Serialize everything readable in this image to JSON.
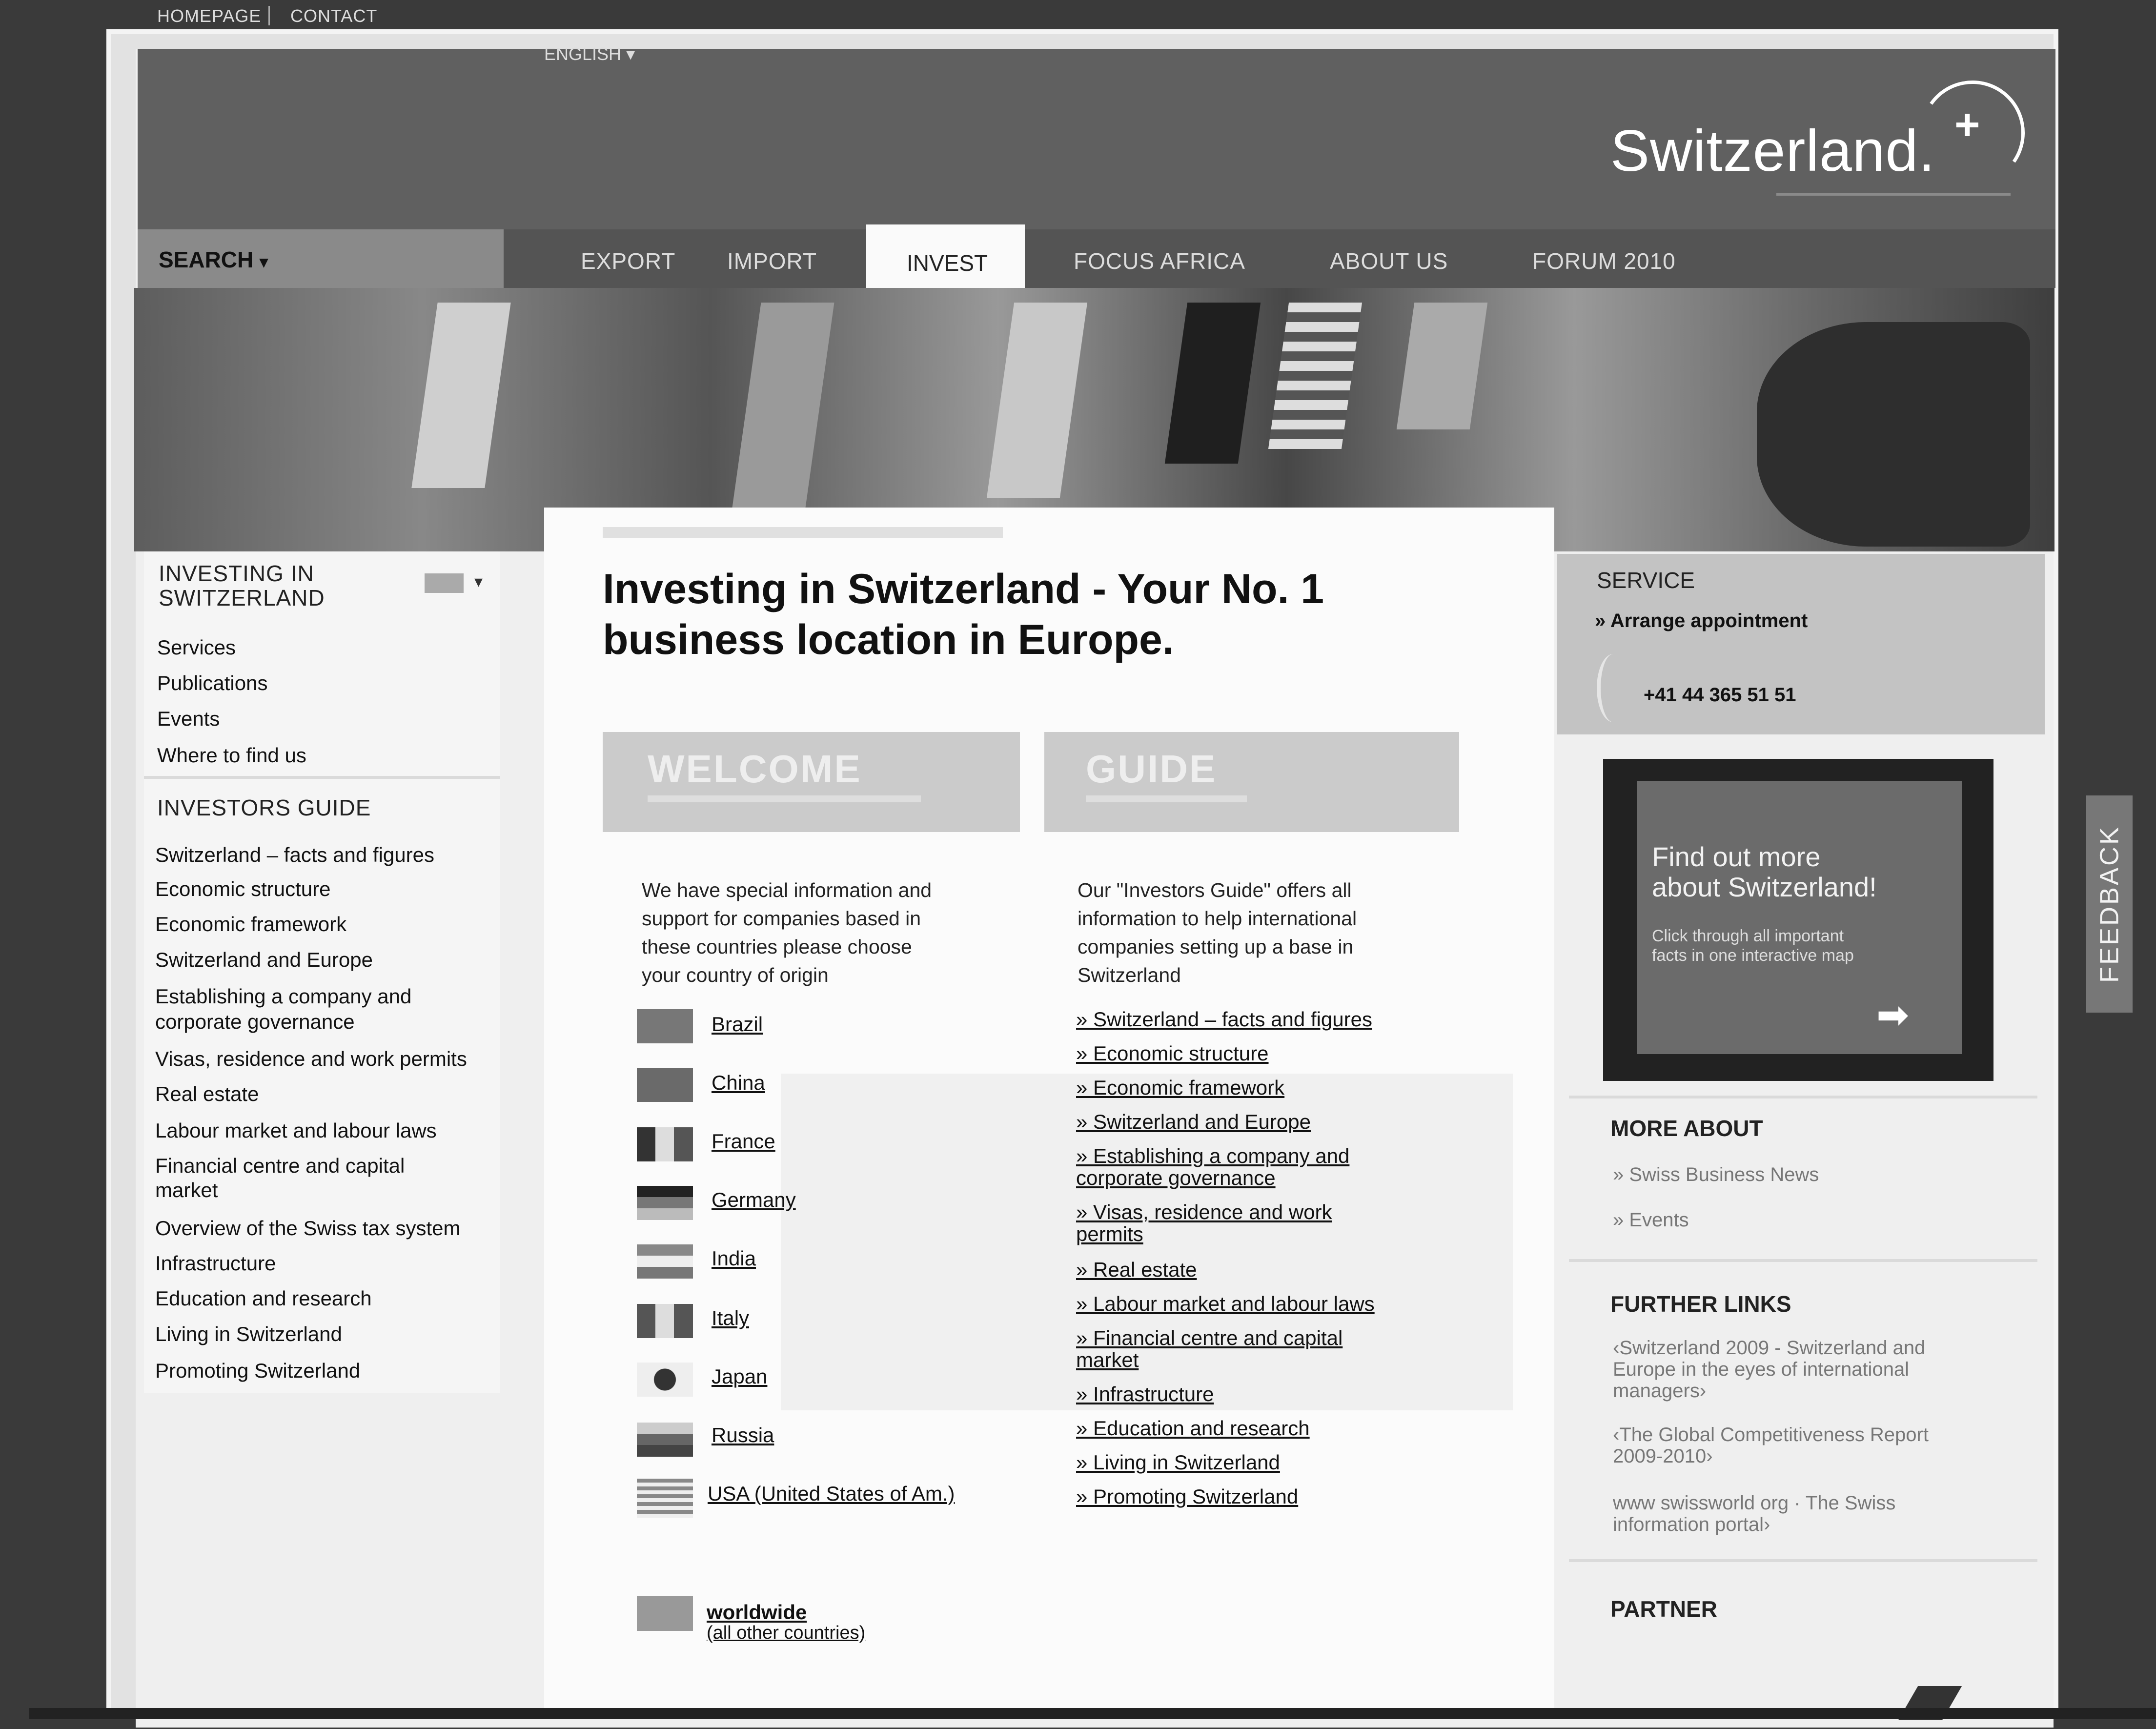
{
  "header": {
    "top_links": [
      "HOMEPAGE",
      "CONTACT"
    ],
    "language": "ENGLISH",
    "logo_text": "Switzerland.",
    "logo_symbol": "+"
  },
  "nav": {
    "search_label": "SEARCH",
    "search_caret": "▾",
    "items": [
      "EXPORT",
      "IMPORT",
      "INVEST",
      "FOCUS AFRICA",
      "ABOUT US",
      "FORUM 2010"
    ]
  },
  "left_nav": {
    "section_title_line1": "INVESTING IN",
    "section_title_line2": "SWITZERLAND",
    "items": [
      "Services",
      "Publications",
      "Events",
      "Where to find us"
    ],
    "guide_title": "INVESTORS GUIDE",
    "guide_items": [
      "Switzerland – facts and figures",
      "Economic structure",
      "Economic framework",
      "Switzerland and Europe",
      "Establishing a company and",
      "corporate governance",
      "Visas, residence and work permits",
      "Real estate",
      "Labour market and labour laws",
      "Financial centre and capital",
      "market",
      "Overview of the Swiss tax system",
      "Infrastructure",
      "Education and research",
      "Living in Switzerland",
      "Promoting Switzerland"
    ]
  },
  "main": {
    "headline_line1": "Investing in Switzerland - Your No. 1",
    "headline_line2": "business location in Europe.",
    "welcome": {
      "title": "WELCOME",
      "text_lines": [
        "We have special information and",
        "support for companies based in",
        "these countries  please choose",
        "your country of origin"
      ],
      "countries": [
        "Brazil",
        "China",
        "France",
        "Germany",
        "India",
        "Italy",
        "Japan",
        "Russia",
        "USA (United States of Am.)"
      ],
      "worldwide_label": "worldwide",
      "worldwide_sub": "(all other countries)"
    },
    "guide": {
      "title": "GUIDE",
      "text_lines": [
        "Our \"Investors Guide\" offers all",
        "information to help international",
        "companies setting up a base in",
        "Switzerland"
      ],
      "links": [
        "» Switzerland – facts and figures",
        "» Economic structure",
        "» Economic framework",
        "» Switzerland and Europe",
        "» Establishing a company and",
        "corporate governance",
        "» Visas, residence and work",
        "permits",
        "» Real estate",
        "» Labour market and labour laws",
        "» Financial centre and capital",
        "market",
        "» Infrastructure",
        "» Education and research",
        "» Living in Switzerland",
        "» Promoting Switzerland"
      ]
    }
  },
  "right": {
    "service_title": "SERVICE",
    "appointment": "» Arrange appointment",
    "phone": "+41 44 365 51 51",
    "promo_line1": "Find out more",
    "promo_line2": "about Switzerland!",
    "promo_sub1": "Click through all important",
    "promo_sub2": "facts in one interactive map",
    "more_about_title": "MORE ABOUT",
    "more_about_items": [
      "Swiss Business News",
      "Events"
    ],
    "further_links_title": "FURTHER LINKS",
    "further_links": [
      [
        "‹Switzerland 2009 - Switzerland and",
        "Europe in the eyes of international",
        "managers›"
      ],
      [
        "‹The Global Competitiveness Report",
        "2009-2010›"
      ],
      [
        "www swissworld org · The Swiss",
        "information portal›"
      ]
    ],
    "partner_title": "PARTNER"
  },
  "feedback_label": "FEEDBACK",
  "colors": {
    "header_bg": "#606060",
    "nav_bg": "#545454",
    "active_tab_bg": "#fafafa",
    "service_bg": "#c3c3c3",
    "promo_bg": "#6b6b6b"
  }
}
